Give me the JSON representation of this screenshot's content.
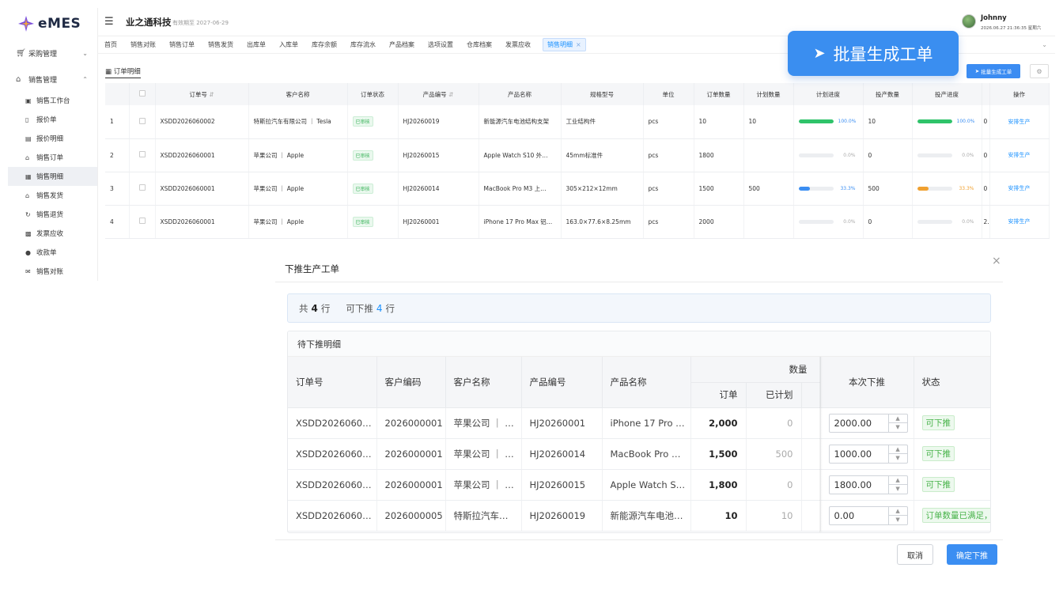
{
  "app": {
    "logo_text": "eMES",
    "company": "业之通科技",
    "validity": "有效期至 2027-06-29"
  },
  "user": {
    "name": "Johnny",
    "time": "2026.06.27 21:36:35 星期六"
  },
  "sidebar": {
    "groups": [
      {
        "label": "采购管理",
        "icon": "cart-icon"
      },
      {
        "label": "销售管理",
        "icon": "home-icon"
      }
    ],
    "items": [
      {
        "label": "销售工作台",
        "icon": "monitor-icon"
      },
      {
        "label": "报价单",
        "icon": "doc-icon"
      },
      {
        "label": "报价明细",
        "icon": "doc-lines-icon"
      },
      {
        "label": "销售订单",
        "icon": "home-icon"
      },
      {
        "label": "销售明细",
        "icon": "list-icon"
      },
      {
        "label": "销售发货",
        "icon": "home-icon"
      },
      {
        "label": "销售退货",
        "icon": "refresh-icon"
      },
      {
        "label": "发票应收",
        "icon": "bank-icon"
      },
      {
        "label": "收款单",
        "icon": "lock-icon"
      },
      {
        "label": "销售对账",
        "icon": "mail-icon"
      }
    ]
  },
  "tabs": [
    "首页",
    "销售对账",
    "销售订单",
    "销售发货",
    "出库单",
    "入库单",
    "库存余额",
    "库存流水",
    "产品档案",
    "选项设置",
    "仓库档案",
    "发票应收",
    "销售明细"
  ],
  "section": {
    "title": "订单明细",
    "batch_btn": "批量生成工单",
    "big_btn": "批量生成工单"
  },
  "main_table": {
    "headers": [
      "",
      "",
      "订单号",
      "客户名称",
      "订单状态",
      "产品编号",
      "产品名称",
      "规格型号",
      "单位",
      "订单数量",
      "计划数量",
      "计划进度",
      "投产数量",
      "投产进度",
      "",
      "操作"
    ],
    "rows": [
      {
        "idx": "1",
        "order": "XSDD2026060002",
        "customer": "特斯拉汽车有限公司 ｜ Tesla",
        "status": "已审核",
        "product_no": "HJ20260019",
        "product": "新能源汽车电池结构支架",
        "spec": "工业结构件",
        "unit": "pcs",
        "qty": "10",
        "plan": "10",
        "plan_pct": 100,
        "plan_text": "100.0%",
        "prod_qty": "10",
        "prod_pct": 100,
        "prod_text": "100.0%",
        "extra": "0",
        "op": "安排生产"
      },
      {
        "idx": "2",
        "order": "XSDD2026060001",
        "customer": "苹果公司 ｜ Apple",
        "status": "已审核",
        "product_no": "HJ20260015",
        "product": "Apple Watch S10 外…",
        "spec": "45mm标准件",
        "unit": "pcs",
        "qty": "1800",
        "plan": "",
        "plan_pct": 0,
        "plan_text": "0.0%",
        "prod_qty": "0",
        "prod_pct": 0,
        "prod_text": "0.0%",
        "extra": "0",
        "op": "安排生产"
      },
      {
        "idx": "3",
        "order": "XSDD2026060001",
        "customer": "苹果公司 ｜ Apple",
        "status": "已审核",
        "product_no": "HJ20260014",
        "product": "MacBook Pro M3 上…",
        "spec": "305×212×12mm",
        "unit": "pcs",
        "qty": "1500",
        "plan": "500",
        "plan_pct": 33.3,
        "plan_text": "33.3%",
        "prod_qty": "500",
        "prod_pct": 33.3,
        "prod_text": "33.3%",
        "extra": "0",
        "op": "安排生产"
      },
      {
        "idx": "4",
        "order": "XSDD2026060001",
        "customer": "苹果公司 ｜ Apple",
        "status": "已审核",
        "product_no": "HJ20260001",
        "product": "iPhone 17 Pro Max 铝…",
        "spec": "163.0×77.6×8.25mm",
        "unit": "pcs",
        "qty": "2000",
        "plan": "",
        "plan_pct": 0,
        "plan_text": "0.0%",
        "prod_qty": "0",
        "prod_pct": 0,
        "prod_text": "0.0%",
        "extra": "20",
        "op": "安排生产"
      }
    ]
  },
  "modal": {
    "title": "下推生产工单",
    "summary": {
      "prefix": "共",
      "total": "4",
      "mid": "行",
      "push_label": "可下推",
      "push_count": "4",
      "suffix": "行"
    },
    "detail_title": "待下推明细",
    "headers": {
      "order": "订单号",
      "cust_code": "客户编码",
      "cust_name": "客户名称",
      "product_no": "产品编号",
      "product": "产品名称",
      "qty_group": "数量",
      "qty_order": "订单",
      "qty_planned": "已计划",
      "push_now": "本次下推",
      "status": "状态"
    },
    "rows": [
      {
        "order": "XSDD20260600…",
        "cust_code": "2026000001",
        "cust_name": "苹果公司 ｜ …",
        "product_no": "HJ20260001",
        "product": "iPhone 17 Pro …",
        "qty": "2,000",
        "planned": "0",
        "push": "2000.00",
        "status": "可下推",
        "status_type": "tag"
      },
      {
        "order": "XSDD20260600…",
        "cust_code": "2026000001",
        "cust_name": "苹果公司 ｜ …",
        "product_no": "HJ20260014",
        "product": "MacBook Pro …",
        "qty": "1,500",
        "planned": "500",
        "push": "1000.00",
        "status": "可下推",
        "status_type": "tag"
      },
      {
        "order": "XSDD20260600…",
        "cust_code": "2026000001",
        "cust_name": "苹果公司 ｜ …",
        "product_no": "HJ20260015",
        "product": "Apple Watch S…",
        "qty": "1,800",
        "planned": "0",
        "push": "1800.00",
        "status": "可下推",
        "status_type": "tag"
      },
      {
        "order": "XSDD20260600…",
        "cust_code": "2026000005",
        "cust_name": "特斯拉汽车…",
        "product_no": "HJ20260019",
        "product": "新能源汽车电池…",
        "qty": "10",
        "planned": "10",
        "push": "0.00",
        "status": "订单数量已满足，",
        "status_type": "tag"
      }
    ],
    "cancel": "取消",
    "confirm": "确定下推"
  },
  "colors": {
    "primary": "#3b8ef2",
    "progress_green": "#2fc36a",
    "progress_blue": "#3b8ef2",
    "progress_orange": "#f0a030",
    "badge_green": "#3bb35b"
  }
}
